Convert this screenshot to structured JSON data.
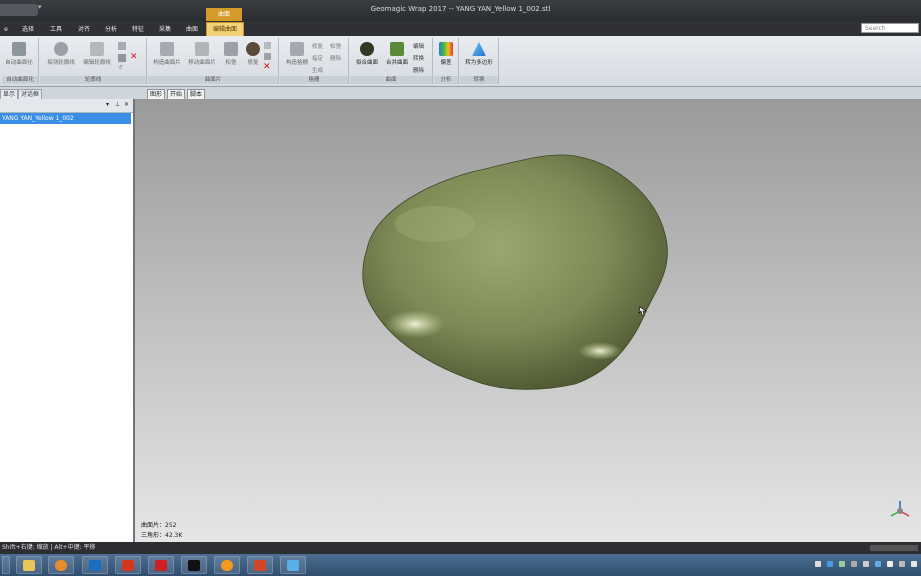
{
  "window": {
    "title": "Geomagic Wrap 2017 -- YANG YAN_Yellow 1_002.stl",
    "context_tab_label": "曲面",
    "search_placeholder": "Search"
  },
  "tabs": [
    {
      "label": "选择",
      "active": false
    },
    {
      "label": "工具",
      "active": false
    },
    {
      "label": "对齐",
      "active": false
    },
    {
      "label": "分析",
      "active": false
    },
    {
      "label": "特征",
      "active": false
    },
    {
      "label": "采集",
      "active": false
    },
    {
      "label": "曲面",
      "active": false
    },
    {
      "label": "编辑曲面",
      "active": true
    }
  ],
  "ribbon": {
    "groups": [
      {
        "label": "自动曲面化",
        "buttons": [
          "自动曲面化"
        ]
      },
      {
        "label": "轮廓线",
        "buttons": [
          "探测轮廓线",
          "编辑轮廓线"
        ]
      },
      {
        "label": "曲面片",
        "buttons": [
          "构造曲面片",
          "移动曲面片",
          "松弛",
          "修复"
        ]
      },
      {
        "label": "格栅",
        "buttons": [
          "构造格栅"
        ],
        "small": [
          "修复",
          "松弛",
          "指定",
          "删除",
          "生成"
        ]
      },
      {
        "label": "曲面",
        "buttons": [
          "拟合曲面",
          "合并曲面"
        ],
        "small": [
          "编辑",
          "转换",
          "删除"
        ]
      },
      {
        "label": "分析",
        "buttons": [
          "偏差"
        ]
      },
      {
        "label": "转换",
        "buttons": [
          "转为多边形"
        ]
      }
    ]
  },
  "panel_tabs": [
    "显示",
    "对话框"
  ],
  "view_tabs": [
    "图形",
    "开始",
    "脚本"
  ],
  "model_tree": {
    "items": [
      "YANG YAN_Yellow 1_002"
    ]
  },
  "stats": {
    "patches": "曲面片：252",
    "triangles": "三角形：42.3K"
  },
  "statusbar": {
    "hint": "Shift+右键: 缩放 | Alt+中键: 平移"
  },
  "taskbar": {
    "apps": [
      "explorer",
      "media",
      "geomagic",
      "wps",
      "solidworks",
      "autodesk",
      "browser",
      "powerpoint",
      "tool"
    ]
  },
  "colors": {
    "accent_tab": "#f4d27a",
    "selection": "#3a8ee6",
    "model": "#8e9a62"
  }
}
